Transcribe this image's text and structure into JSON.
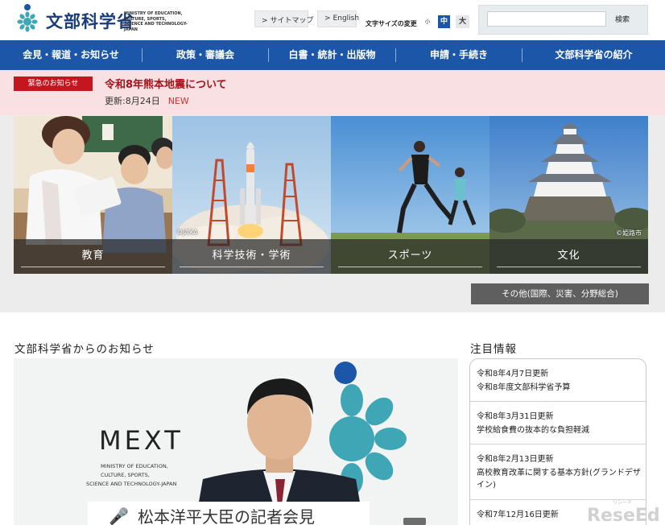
{
  "header": {
    "logo_jp": "文部科学省",
    "logo_en_lines": [
      "MINISTRY OF EDUCATION,",
      "CULTURE, SPORTS,",
      "SCIENCE AND TECHNOLOGY-JAPAN"
    ],
    "sitemap_label": "サイトマップ",
    "english_label": "English",
    "font_size_label": "文字サイズの変更",
    "font_small": "小",
    "font_mid": "中",
    "font_large": "大",
    "search_button": "検索",
    "search_value": "",
    "search_placeholder": ""
  },
  "gnav": [
    "会見・報道・お知らせ",
    "政策・審議会",
    "白書・統計・出版物",
    "申請・手続き",
    "文部科学省の紹介"
  ],
  "alert": {
    "tag": "緊急のお知らせ",
    "title": "令和8年熊本地震について",
    "updated": "更新:8月24日",
    "new_badge": "NEW"
  },
  "categories": [
    {
      "label": "教育",
      "credit": ""
    },
    {
      "label": "科学技術・学術",
      "credit": "©JAXA"
    },
    {
      "label": "スポーツ",
      "credit": ""
    },
    {
      "label": "文化",
      "credit": "©姫路市"
    }
  ],
  "other_button": "その他(国際、災害、分野総合)",
  "news": {
    "title": "文部科学省からのお知らせ",
    "image_mext": "MEXT",
    "image_mext_lines": [
      "MINISTRY OF EDUCATION,",
      "CULTURE, SPORTS,",
      "SCIENCE AND TECHNOLOGY-JAPAN"
    ],
    "banner": "松本洋平大臣の記者会見"
  },
  "attention": {
    "title": "注目情報",
    "items": [
      {
        "date": "令和8年4月7日更新",
        "text": "令和8年度文部科学省予算"
      },
      {
        "date": "令和8年3月31日更新",
        "text": "学校給食費の抜本的な負担軽減"
      },
      {
        "date": "令和8年2月13日更新",
        "text": "高校教育改革に関する基本方針(グランドデザイン)"
      },
      {
        "date": "令和7年12月16日更新",
        "text": ""
      }
    ]
  },
  "watermark": {
    "small": "リシード",
    "big": "ReseEd"
  },
  "colors": {
    "nav_blue": "#1b56a8",
    "alert_red": "#c3161e",
    "alert_bg": "#f9e0e2",
    "logo_teal": "#3fa6b6"
  }
}
